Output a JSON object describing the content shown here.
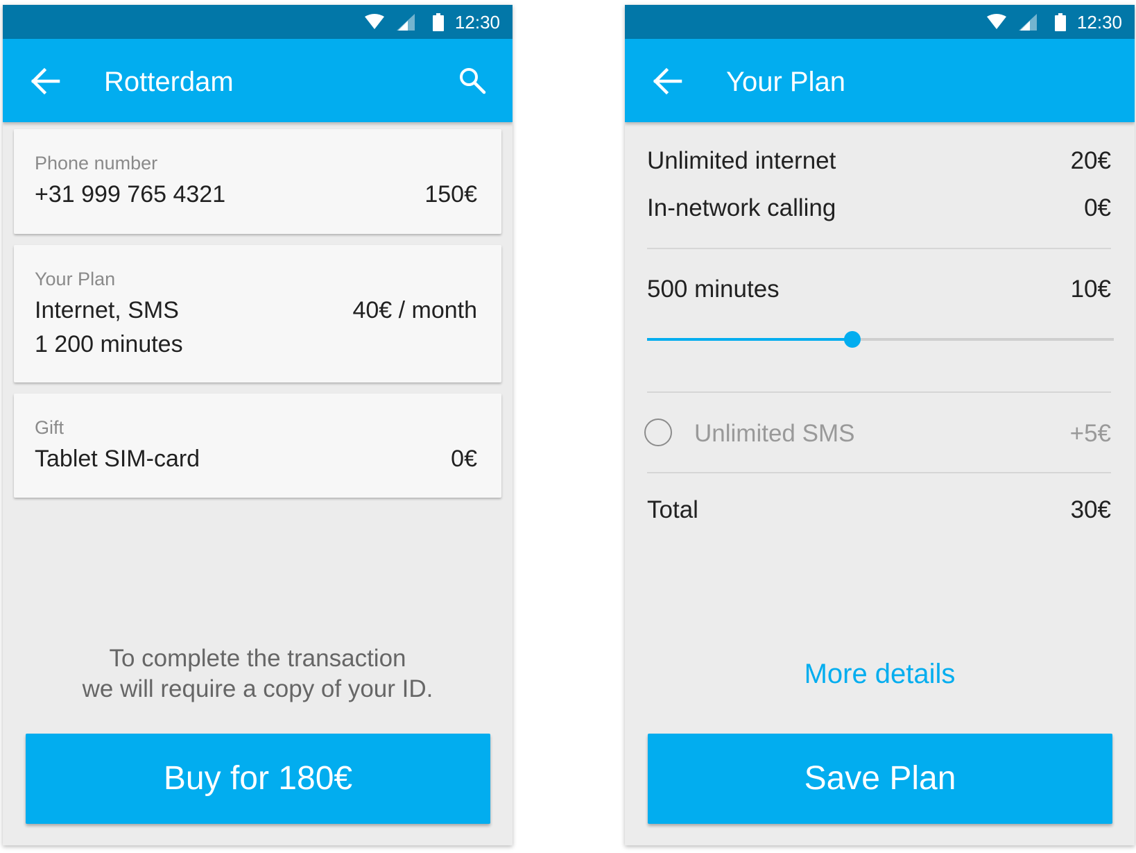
{
  "status_bar": {
    "time": "12:30"
  },
  "left_screen": {
    "title": "Rotterdam",
    "phone_card": {
      "label": "Phone number",
      "value": "+31 999 765 4321",
      "price": "150€"
    },
    "plan_card": {
      "label": "Your Plan",
      "line1": "Internet, SMS",
      "line2": "1 200 minutes",
      "price": "40€ / month"
    },
    "gift_card": {
      "label": "Gift",
      "value": "Tablet SIM-card",
      "price": "0€"
    },
    "info_line1": "To complete the transaction",
    "info_line2": "we will require a copy of your ID.",
    "buy_label": "Buy for 180€"
  },
  "right_screen": {
    "title": "Your Plan",
    "items": [
      {
        "label": "Unlimited internet",
        "price": "20€"
      },
      {
        "label": "In-network calling",
        "price": "0€"
      }
    ],
    "minutes": {
      "label": "500 minutes",
      "price": "10€",
      "slider_fraction": 0.44
    },
    "sms_option": {
      "label": "Unlimited SMS",
      "price": "+5€",
      "selected": false
    },
    "total": {
      "label": "Total",
      "price": "30€"
    },
    "more_details": "More details",
    "save_label": "Save Plan"
  },
  "colors": {
    "status_bar": "#0277a8",
    "app_bar": "#02adef",
    "accent": "#02adef",
    "background": "#ececec"
  }
}
